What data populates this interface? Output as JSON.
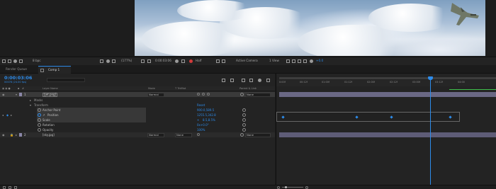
{
  "viewer": {
    "bottom_bar": {
      "zoom": "(177%)",
      "timecode": "0:00:03:06",
      "resolution": "Half",
      "camera": "Active Camera",
      "views": "1 View",
      "exposure": "+0.0",
      "bits": "8 bpc"
    }
  },
  "tabs": {
    "render_queue": "Render Queue",
    "comp": "Comp 1"
  },
  "timeline": {
    "current_time": "0:00:03:06",
    "current_frame": "00078 (24.00 fps)",
    "columns": {
      "layer_name": "Layer Name",
      "mode": "Mode",
      "trkmat": "T TrkMat",
      "parent": "Parent & Link"
    },
    "layers": [
      {
        "index": "1",
        "name": "[jet.png]",
        "mode": "Normal",
        "parent": "None"
      },
      {
        "index": "2",
        "name": "[sky.jpg]",
        "mode": "Normal",
        "trkmat": "None",
        "parent": "None"
      }
    ],
    "groups": {
      "masks": "Masks",
      "transform": "Transform",
      "reset": "Reset"
    },
    "properties": [
      {
        "name": "Anchor Point",
        "value": "900.0,589.5"
      },
      {
        "name": "Position",
        "value": "1255.5,342.8"
      },
      {
        "name": "Scale",
        "value": "8.5,8.5%"
      },
      {
        "name": "Rotation",
        "value": "0x+0.0°"
      },
      {
        "name": "Opacity",
        "value": "100%"
      }
    ],
    "ruler_ticks": [
      "0:00f",
      "00:12f",
      "01:00f",
      "01:12f",
      "02:00f",
      "02:12f",
      "03:00f",
      "03:12f",
      "04:00"
    ]
  },
  "colors": {
    "accent": "#2d8ceb",
    "layer_bar": "#5e5c77",
    "panel_bg": "#232323"
  }
}
